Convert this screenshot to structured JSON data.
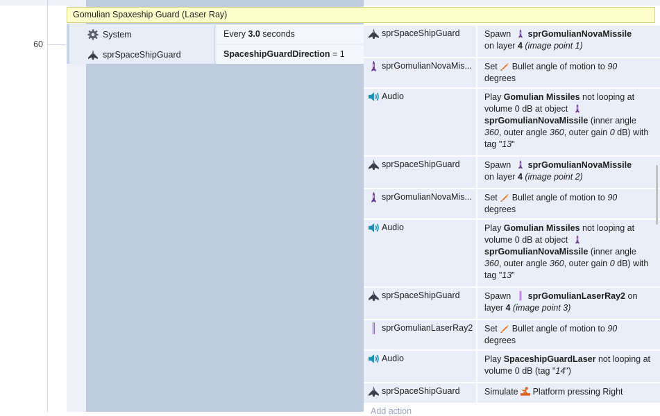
{
  "line_number": "60",
  "group": {
    "title": "Gomulian Spaxeship Guard (Laser Ray)"
  },
  "conditions": [
    {
      "object": "System",
      "icon": "gear-icon",
      "text_pre": "Every ",
      "value": "3.0",
      "text_post": " seconds"
    },
    {
      "object": "sprSpaceShipGuard",
      "icon": "spaceship-icon",
      "var_name": "SpaceshipGuardDirection",
      "op": " = ",
      "value": "1"
    }
  ],
  "actions": [
    {
      "object": "sprSpaceShipGuard",
      "icon": "spaceship-icon",
      "spawn": "Spawn",
      "target": "sprGomulianNovaMissile",
      "on_layer": "on layer ",
      "layer": "4",
      "point": "(image point 1)"
    },
    {
      "object": "sprGomulianNovaMis...",
      "icon": "missile-icon",
      "set": "Set",
      "behavior": "Bullet",
      "prop": " angle of motion to ",
      "value": "90",
      "unit": "degrees"
    },
    {
      "object": "Audio",
      "icon": "speaker-icon",
      "play": "Play ",
      "sound": "Gomulian Missiles",
      "rest1": " not looping at volume 0 dB at object",
      "target": "sprGomulianNovaMissile",
      "p1": " (inner angle ",
      "v1": "360",
      "p2": ", outer angle ",
      "v2": "360",
      "p3": ", outer gain ",
      "v3": "0",
      "p4": " dB) with tag \"",
      "tag": "13",
      "p5": "\""
    },
    {
      "object": "sprSpaceShipGuard",
      "icon": "spaceship-icon",
      "spawn": "Spawn",
      "target": "sprGomulianNovaMissile",
      "on_layer": "on layer ",
      "layer": "4",
      "point": "(image point 2)"
    },
    {
      "object": "sprGomulianNovaMis...",
      "icon": "missile-icon",
      "set": "Set",
      "behavior": "Bullet",
      "prop": " angle of motion to ",
      "value": "90",
      "unit": "degrees"
    },
    {
      "object": "Audio",
      "icon": "speaker-icon",
      "play": "Play ",
      "sound": "Gomulian Missiles",
      "rest1": " not looping at volume 0 dB at object",
      "target": "sprGomulianNovaMissile",
      "p1": " (inner angle ",
      "v1": "360",
      "p2": ", outer angle ",
      "v2": "360",
      "p3": ", outer gain ",
      "v3": "0",
      "p4": " dB) with tag \"",
      "tag": "13",
      "p5": "\""
    },
    {
      "object": "sprSpaceShipGuard",
      "icon": "spaceship-icon",
      "spawn": "Spawn",
      "target": "sprGomulianLaserRay2",
      "on_layer": " on layer ",
      "layer": "4",
      "point": "(image point 3)"
    },
    {
      "object": "sprGomulianLaserRay2",
      "icon": "laser-icon",
      "set": "Set",
      "behavior": "Bullet",
      "prop": " angle of motion to ",
      "value": "90",
      "unit": "degrees"
    },
    {
      "object": "Audio",
      "icon": "speaker-icon",
      "play": "Play ",
      "sound": "SpaceshipGuardLaser",
      "rest": " not looping at volume 0 dB (tag \"",
      "tag": "14",
      "rest_end": "\")"
    },
    {
      "object": "sprSpaceShipGuard",
      "icon": "spaceship-icon",
      "simulate": "Simulate ",
      "behavior": "Platform",
      "rest": " pressing Right"
    }
  ],
  "add_action": "Add action",
  "colors": {
    "group_header": "#ffffcc",
    "action_bg": "#e9eef8",
    "event_strip": "#bfcbde"
  }
}
